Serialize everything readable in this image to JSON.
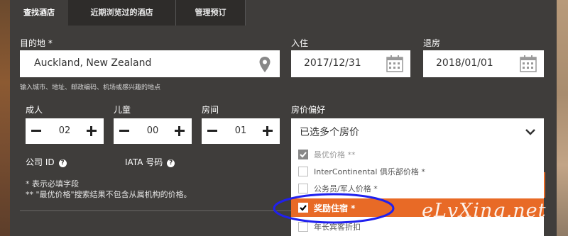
{
  "tabs": [
    {
      "label": "查找酒店"
    },
    {
      "label": "近期浏览过的酒店"
    },
    {
      "label": "管理预订"
    }
  ],
  "destination": {
    "label": "目的地 *",
    "value": "Auckland, New Zealand",
    "hint": "输入城市、地址、邮政编码、机场或感兴趣的地点"
  },
  "checkin": {
    "label": "入住",
    "value": "2017/12/31"
  },
  "checkout": {
    "label": "退房",
    "value": "2018/01/01"
  },
  "adults": {
    "label": "成人",
    "value": "02"
  },
  "children": {
    "label": "儿童",
    "value": "00"
  },
  "rooms": {
    "label": "房间",
    "value": "01"
  },
  "rate": {
    "label": "房价偏好",
    "selected": "已选多个房价",
    "options": [
      {
        "label": "最优价格 **",
        "checked": true,
        "disabled": true
      },
      {
        "label": "InterContinental 俱乐部价格 *",
        "checked": false
      },
      {
        "label": "公务员/军人价格 *",
        "checked": false
      },
      {
        "label": "奖励住宿 *",
        "checked": true,
        "highlighted": true
      },
      {
        "label": "年长宾客折扣",
        "checked": false
      }
    ]
  },
  "corporate_id": {
    "label": "公司 ID"
  },
  "iata": {
    "label": "IATA 号码"
  },
  "notes": {
    "required": "* 表示必填字段",
    "best_rate": "** \"最优价格\"搜索结果不包含从属机构的价格。"
  },
  "watermark": "eLvXing.net",
  "colors": {
    "accent": "#e86a26",
    "panel": "#3f3d3b",
    "annotation": "#2020ee"
  }
}
